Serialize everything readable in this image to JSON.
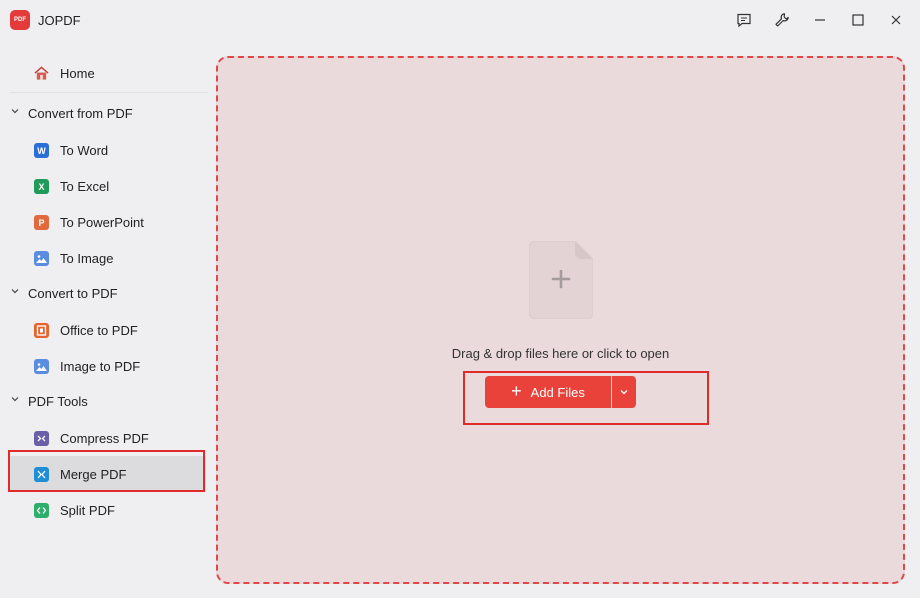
{
  "app": {
    "title": "JOPDF",
    "logo_text": "PDF"
  },
  "window_controls": [
    {
      "name": "feedback-icon"
    },
    {
      "name": "settings-wrench-icon"
    },
    {
      "name": "minimize-icon"
    },
    {
      "name": "maximize-icon"
    },
    {
      "name": "close-icon"
    }
  ],
  "sidebar": {
    "home": {
      "label": "Home",
      "icon": "home-icon"
    },
    "sections": [
      {
        "label": "Convert from PDF",
        "items": [
          {
            "label": "To Word",
            "icon": "word-icon",
            "glyph": "W",
            "color": "#2b6fd6"
          },
          {
            "label": "To Excel",
            "icon": "excel-icon",
            "glyph": "X",
            "color": "#1f9a58"
          },
          {
            "label": "To PowerPoint",
            "icon": "powerpoint-icon",
            "glyph": "P",
            "color": "#e06a3d"
          },
          {
            "label": "To Image",
            "icon": "image-icon",
            "glyph": "",
            "color": "#5a8de0"
          }
        ]
      },
      {
        "label": "Convert to PDF",
        "items": [
          {
            "label": "Office to PDF",
            "icon": "office-icon",
            "glyph": "",
            "color": "#e8622e"
          },
          {
            "label": "Image to PDF",
            "icon": "image-icon",
            "glyph": "",
            "color": "#5a8de0"
          }
        ]
      },
      {
        "label": "PDF Tools",
        "items": [
          {
            "label": "Compress PDF",
            "icon": "compress-icon",
            "glyph": "",
            "color": "#6b5fa8"
          },
          {
            "label": "Merge PDF",
            "icon": "merge-icon",
            "glyph": "",
            "color": "#1e8fd6",
            "active": true
          },
          {
            "label": "Split PDF",
            "icon": "split-icon",
            "glyph": "",
            "color": "#2eae6a"
          }
        ]
      }
    ]
  },
  "dropzone": {
    "text": "Drag & drop files here or click to open",
    "add_button_label": "Add Files",
    "accent": "#e8423b"
  }
}
